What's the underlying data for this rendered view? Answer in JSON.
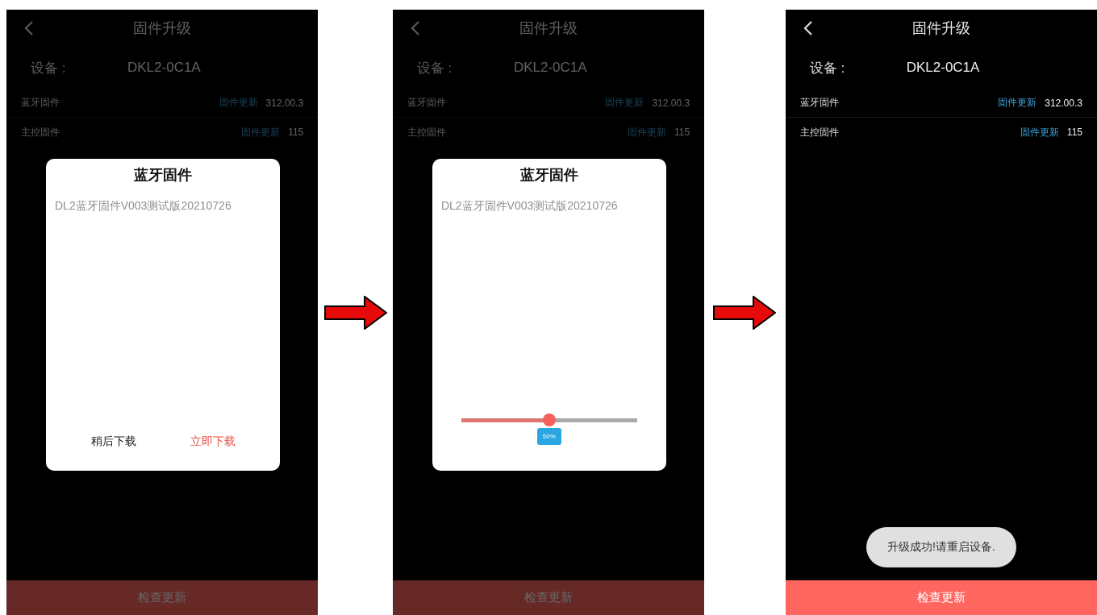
{
  "screens": [
    {
      "header": {
        "title": "固件升级"
      },
      "device": {
        "label": "设备 :",
        "value": "DKL2-0C1A"
      },
      "firmware": [
        {
          "name": "蓝牙固件",
          "action": "固件更新",
          "version": "312.00.3"
        },
        {
          "name": "主控固件",
          "action": "固件更新",
          "version": "115"
        }
      ],
      "check_button": "检查更新",
      "dialog": {
        "kind": "choice",
        "title": "蓝牙固件",
        "description": "DL2蓝牙固件V003测试版20210726",
        "buttons": [
          {
            "label": "稍后下载",
            "kind": "secondary"
          },
          {
            "label": "立即下载",
            "kind": "primary"
          }
        ]
      }
    },
    {
      "header": {
        "title": "固件升级"
      },
      "device": {
        "label": "设备 :",
        "value": "DKL2-0C1A"
      },
      "firmware": [
        {
          "name": "蓝牙固件",
          "action": "固件更新",
          "version": "312.00.3"
        },
        {
          "name": "主控固件",
          "action": "固件更新",
          "version": "115"
        }
      ],
      "check_button": "检查更新",
      "dialog": {
        "kind": "progress",
        "title": "蓝牙固件",
        "description": "DL2蓝牙固件V003测试版20210726",
        "level": 0.5,
        "reading": "50%"
      }
    },
    {
      "header": {
        "title": "固件升级"
      },
      "device": {
        "label": "设备 :",
        "value": "DKL2-0C1A"
      },
      "firmware": [
        {
          "name": "蓝牙固件",
          "action": "固件更新",
          "version": "312.00.3"
        },
        {
          "name": "主控固件",
          "action": "固件更新",
          "version": "115"
        }
      ],
      "check_button": "检查更新",
      "toast": "升级成功!请重启设备."
    }
  ]
}
